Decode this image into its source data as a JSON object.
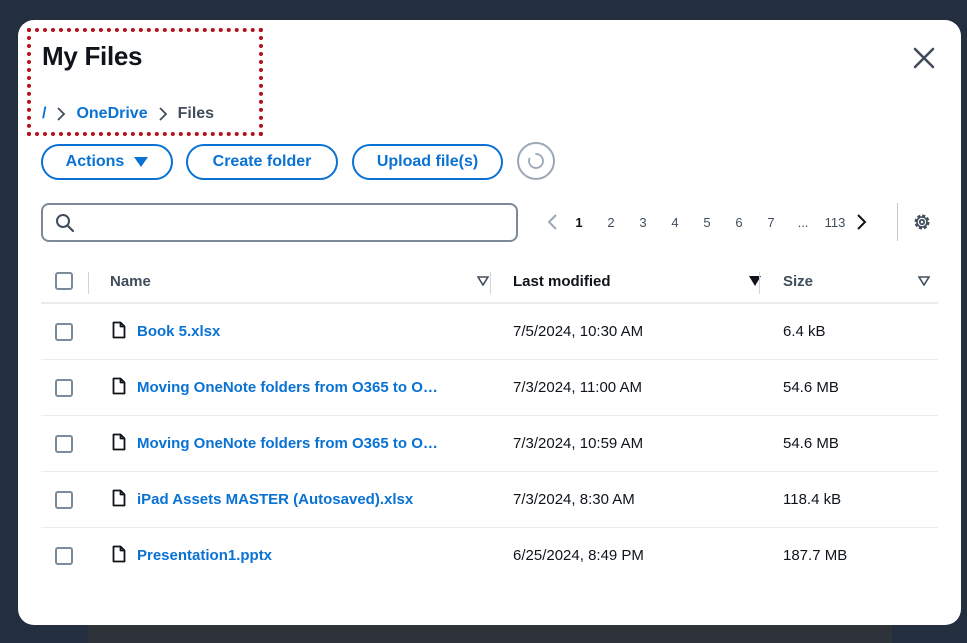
{
  "modal": {
    "title": "My Files",
    "close_icon": "close-icon"
  },
  "breadcrumb": {
    "root": "/",
    "items": [
      {
        "label": "OneDrive",
        "link": true
      },
      {
        "label": "Files",
        "link": false
      }
    ]
  },
  "toolbar": {
    "actions_label": "Actions",
    "create_folder_label": "Create folder",
    "upload_label": "Upload file(s)",
    "refresh_icon": "refresh-icon"
  },
  "search": {
    "placeholder": "",
    "value": ""
  },
  "pagination": {
    "pages": [
      "1",
      "2",
      "3",
      "4",
      "5",
      "6",
      "7"
    ],
    "ellipsis": "...",
    "last_page": "113",
    "current": "1"
  },
  "table": {
    "columns": {
      "name": "Name",
      "modified": "Last modified",
      "size": "Size"
    },
    "sorted_by": "Last modified",
    "rows": [
      {
        "name": "Book 5.xlsx",
        "modified": "7/5/2024, 10:30 AM",
        "size": "6.4 kB"
      },
      {
        "name": "Moving OneNote folders from O365 to O…",
        "modified": "7/3/2024, 11:00 AM",
        "size": "54.6 MB"
      },
      {
        "name": "Moving OneNote folders from O365 to O…",
        "modified": "7/3/2024, 10:59 AM",
        "size": "54.6 MB"
      },
      {
        "name": "iPad Assets MASTER (Autosaved).xlsx",
        "modified": "7/3/2024, 8:30 AM",
        "size": "118.4 kB"
      },
      {
        "name": "Presentation1.pptx",
        "modified": "6/25/2024, 8:49 PM",
        "size": "187.7 MB"
      }
    ]
  },
  "colors": {
    "accent": "#0972d3",
    "focus_outline": "#b3121d",
    "backdrop": "#232f3e"
  }
}
